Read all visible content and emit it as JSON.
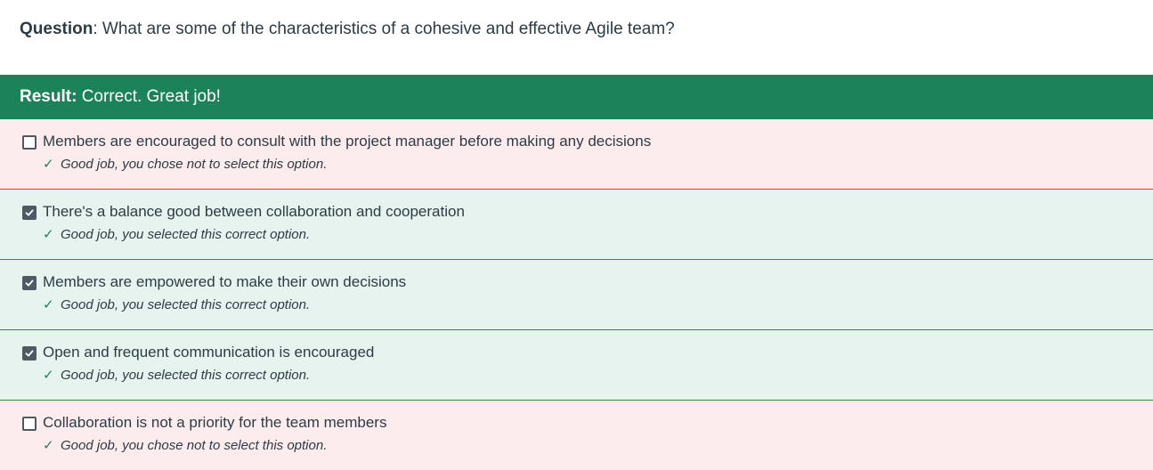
{
  "question": {
    "label": "Question",
    "separator": ":",
    "text": "What are some of the characteristics of a cohesive and effective Agile team?"
  },
  "result": {
    "label": "Result:",
    "text": "Correct. Great job!"
  },
  "options": [
    {
      "text": "Members are encouraged to consult with the project manager before making any decisions",
      "checked": false,
      "feedback": "Good job, you chose not to select this option."
    },
    {
      "text": "There's a balance good between collaboration and cooperation",
      "checked": true,
      "feedback": "Good job, you selected this correct option."
    },
    {
      "text": "Members are empowered to make their own decisions",
      "checked": true,
      "feedback": "Good job, you selected this correct option."
    },
    {
      "text": "Open and frequent communication is encouraged",
      "checked": true,
      "feedback": "Good job, you selected this correct option."
    },
    {
      "text": "Collaboration is not a priority for the team members",
      "checked": false,
      "feedback": "Good job, you chose not to select this option."
    }
  ],
  "icons": {
    "feedback_check": "check-icon",
    "checkbox_checked": "checkbox-checked-icon",
    "checkbox_unchecked": "checkbox-unchecked-icon"
  },
  "colors": {
    "result_bar": "#1c8259",
    "incorrect_row_bg": "#fdecee",
    "correct_row_bg": "#e7f3ee"
  }
}
